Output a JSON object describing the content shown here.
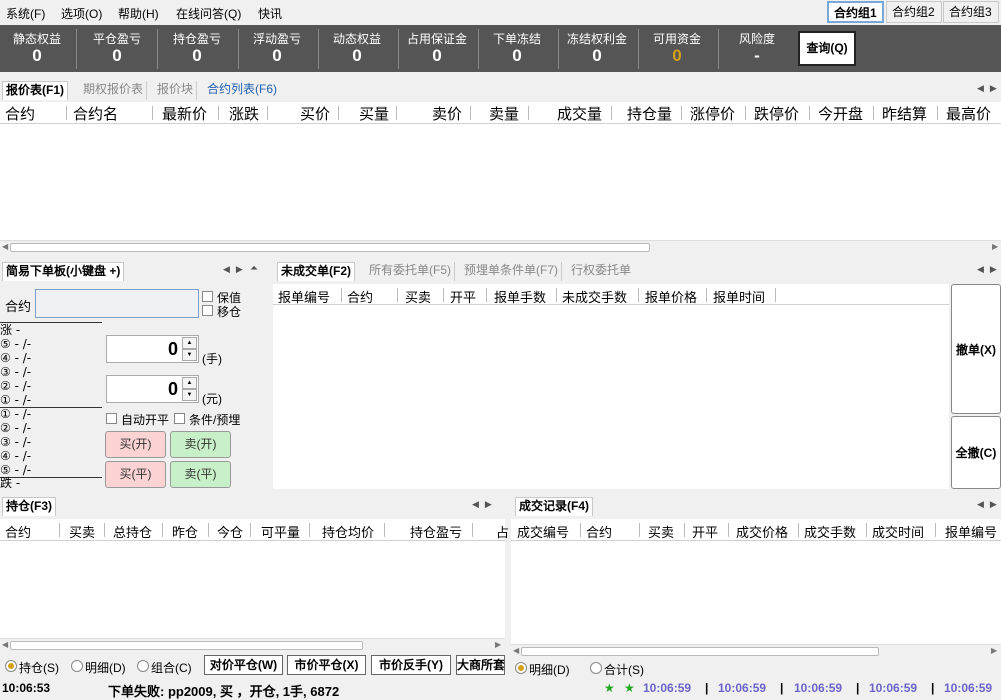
{
  "menu": [
    "系统(F)",
    "选项(O)",
    "帮助(H)",
    "在线问答(Q)",
    "快讯"
  ],
  "contract_groups": [
    "合约组1",
    "合约组2",
    "合约组3"
  ],
  "account_info": [
    {
      "label": "静态权益",
      "value": "0"
    },
    {
      "label": "平仓盈亏",
      "value": "0"
    },
    {
      "label": "持仓盈亏",
      "value": "0"
    },
    {
      "label": "浮动盈亏",
      "value": "0"
    },
    {
      "label": "动态权益",
      "value": "0"
    },
    {
      "label": "占用保证金",
      "value": "0"
    },
    {
      "label": "下单冻结",
      "value": "0"
    },
    {
      "label": "冻结权利金",
      "value": "0"
    },
    {
      "label": "可用资金",
      "value": "0"
    },
    {
      "label": "风险度",
      "value": "-"
    }
  ],
  "colors": {
    "available_funds_value": "#d4a017",
    "status_time": "#6b63c8",
    "status_star": "#1fa81f"
  },
  "query_button": "查询(Q)",
  "quote_tabs": [
    "报价表(F1)",
    "期权报价表",
    "报价块",
    "合约列表(F6)"
  ],
  "quote_columns": [
    "合约",
    "合约名",
    "最新价",
    "涨跌",
    "买价",
    "买量",
    "卖价",
    "卖量",
    "成交量",
    "持仓量",
    "涨停价",
    "跌停价",
    "今开盘",
    "昨结算",
    "最高价"
  ],
  "order_panel": {
    "tab": "简易下单板(小键盘 +)",
    "contract_label": "合约",
    "contract_value": "",
    "hedge_label": "保值",
    "move_label": "移仓",
    "qty_value": "0",
    "qty_unit": "(手)",
    "price_value": "0",
    "price_unit": "(元)",
    "auto_open_close": "自动开平",
    "conditional": "条件/预埋",
    "buy_open": "买(开)",
    "sell_open": "卖(开)",
    "buy_close": "买(平)",
    "sell_close": "卖(平)",
    "depth": [
      "涨 -",
      "⑤ - /-",
      "④ - /-",
      "③ - /-",
      "② - /-",
      "① - /-",
      "① - /-",
      "② - /-",
      "③ - /-",
      "④ - /-",
      "⑤ - /-",
      "跌 -"
    ]
  },
  "orders_tabs": [
    "未成交单(F2)",
    "所有委托单(F5)",
    "预埋单条件单(F7)",
    "行权委托单"
  ],
  "orders_columns": [
    "报单编号",
    "合约",
    "买卖",
    "开平",
    "报单手数",
    "未成交手数",
    "报单价格",
    "报单时间"
  ],
  "cancel_button": "撤单(X)",
  "cancel_all_button": "全撤(C)",
  "positions_tab": "持仓(F3)",
  "positions_columns": [
    "合约",
    "买卖",
    "总持仓",
    "昨仓",
    "今仓",
    "可平量",
    "持仓均价",
    "持仓盈亏",
    "占"
  ],
  "positions_radios": [
    "持仓(S)",
    "明细(D)",
    "组合(C)"
  ],
  "positions_buttons": [
    "对价平仓(W)",
    "市价平仓(X)",
    "市价反手(Y)",
    "大商所套"
  ],
  "trades_tab": "成交记录(F4)",
  "trades_columns": [
    "成交编号",
    "合约",
    "买卖",
    "开平",
    "成交价格",
    "成交手数",
    "成交时间",
    "报单编号"
  ],
  "trades_radios": [
    "明细(D)",
    "合计(S)"
  ],
  "status": {
    "time": "10:06:53",
    "message": "下单失败: pp2009, 买 ，开仓, 1手, 6872",
    "stars": [
      "★",
      "★"
    ],
    "times": [
      "10:06:59",
      "10:06:59",
      "10:06:59",
      "10:06:59",
      "10:06:59"
    ]
  }
}
